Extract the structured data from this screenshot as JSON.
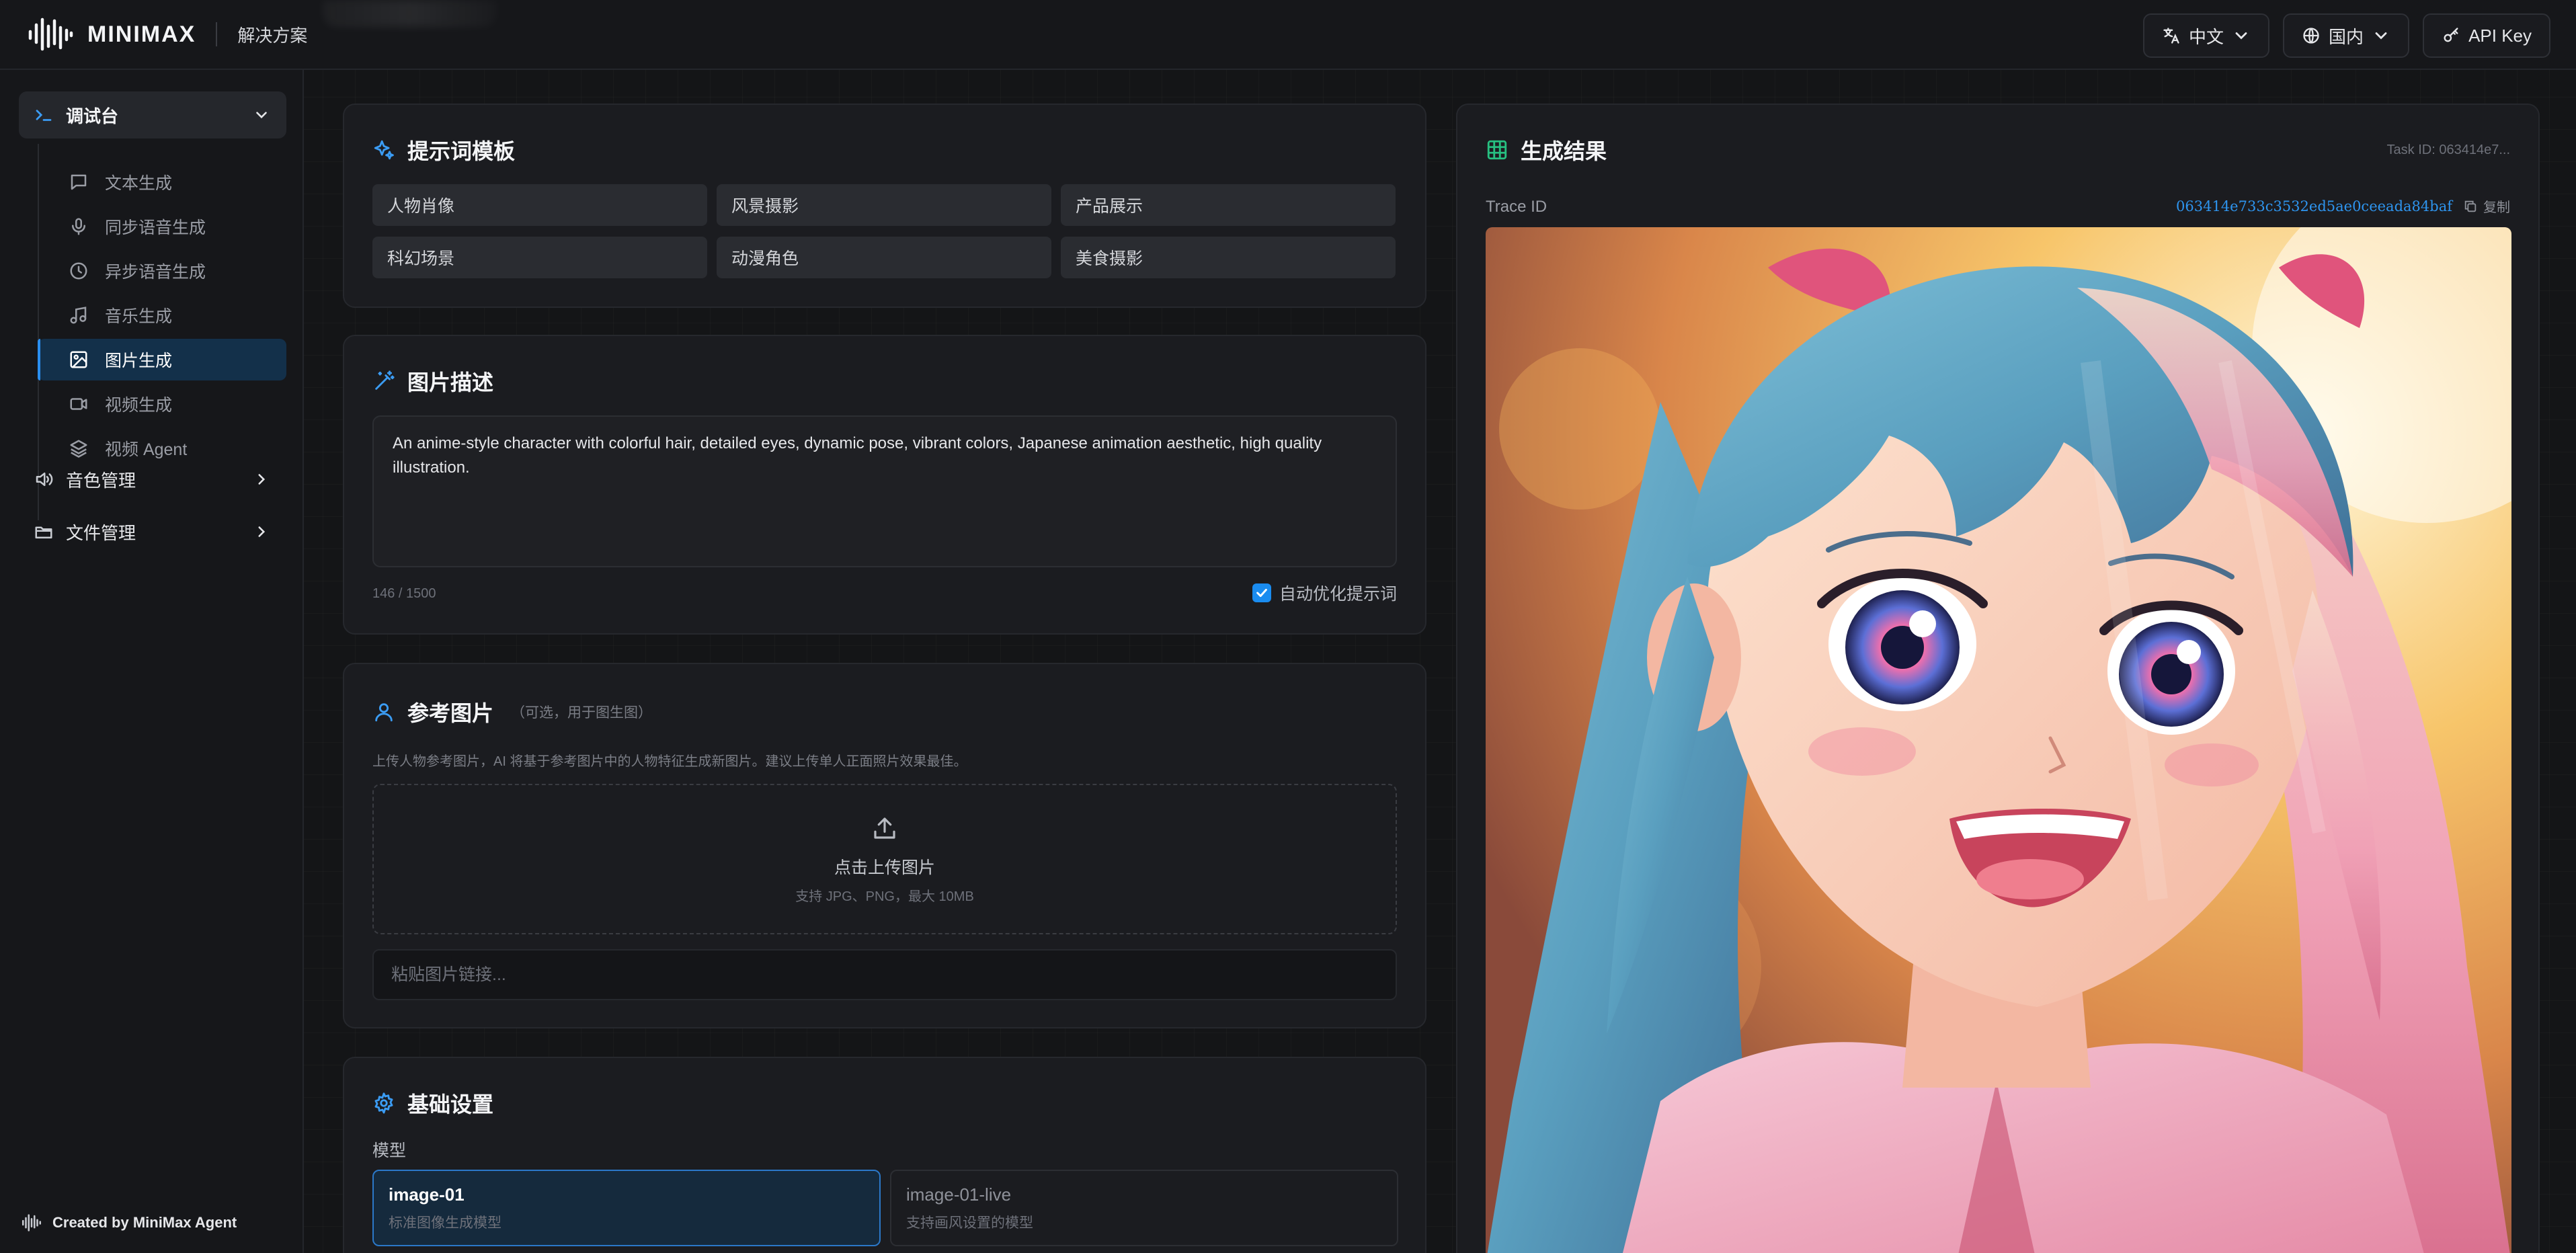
{
  "header": {
    "brand": "MINIMAX",
    "solutions": "解决方案",
    "lang_btn": "中文",
    "region_btn": "国内",
    "apikey_btn": "API Key"
  },
  "sidebar": {
    "group_label": "调试台",
    "items": [
      {
        "label": "文本生成",
        "icon": "chat-icon"
      },
      {
        "label": "同步语音生成",
        "icon": "mic-icon"
      },
      {
        "label": "异步语音生成",
        "icon": "clock-icon"
      },
      {
        "label": "音乐生成",
        "icon": "music-icon"
      },
      {
        "label": "图片生成",
        "icon": "image-icon",
        "active": true
      },
      {
        "label": "视频生成",
        "icon": "video-icon"
      },
      {
        "label": "视频 Agent",
        "icon": "layers-icon"
      }
    ],
    "voice_mgmt": "音色管理",
    "file_mgmt": "文件管理",
    "credit": "Created by MiniMax Agent"
  },
  "templates": {
    "title": "提示词模板",
    "items": [
      "人物肖像",
      "风景摄影",
      "产品展示",
      "科幻场景",
      "动漫角色",
      "美食摄影"
    ]
  },
  "description": {
    "title": "图片描述",
    "text": "An anime-style character with colorful hair, detailed eyes, dynamic pose, vibrant colors, Japanese animation aesthetic, high quality illustration.",
    "counter": "146 / 1500",
    "auto_optimize": "自动优化提示词",
    "auto_optimize_checked": true
  },
  "reference": {
    "title": "参考图片",
    "title_note": "（可选，用于图生图）",
    "hint": "上传人物参考图片，AI 将基于参考图片中的人物特征生成新图片。建议上传单人正面照片效果最佳。",
    "upload_main": "点击上传图片",
    "upload_sub": "支持 JPG、PNG，最大 10MB",
    "url_placeholder": "粘贴图片链接..."
  },
  "basic": {
    "title": "基础设置",
    "model_label": "模型",
    "models": [
      {
        "name": "image-01",
        "desc": "标准图像生成模型",
        "selected": true
      },
      {
        "name": "image-01-live",
        "desc": "支持画风设置的模型",
        "selected": false
      }
    ]
  },
  "result": {
    "title": "生成结果",
    "task_id": "Task ID: 063414e7...",
    "trace_label": "Trace ID",
    "trace_value": "063414e733c3532ed5ae0ceeada84baf",
    "copy_label": "复制",
    "image_icon": "anime-portrait-image"
  },
  "colors": {
    "accent": "#2a8ff0",
    "active_nav_bg": "#13304a",
    "results_icon": "#27c081",
    "template_icon": "#3b9cf4"
  }
}
